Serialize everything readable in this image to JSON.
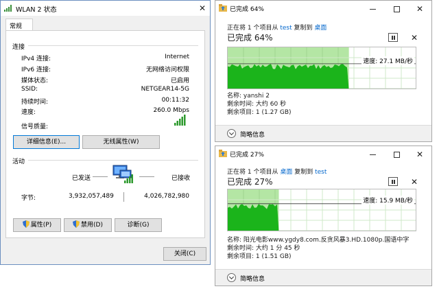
{
  "wlan": {
    "title": "WLAN 2 状态",
    "tab": "常规",
    "connection": {
      "heading": "连接",
      "rows": [
        {
          "label": "IPv4 连接:",
          "value": "Internet"
        },
        {
          "label": "IPv6 连接:",
          "value": "无网络访问权限"
        },
        {
          "label": "媒体状态:",
          "value": "已启用"
        },
        {
          "label": "SSID:",
          "value": "NETGEAR14-5G"
        },
        {
          "label": "持续时间:",
          "value": "00:11:32"
        },
        {
          "label": "速度:",
          "value": "260.0 Mbps"
        }
      ],
      "signal_label": "信号质量:",
      "signal_bars": 5
    },
    "buttons": {
      "details": "详细信息(E)...",
      "wireless_props": "无线属性(W)"
    },
    "activity": {
      "heading": "活动",
      "sent_label": "已发送",
      "received_label": "已接收",
      "bytes_label": "字节:",
      "sent_bytes": "3,932,057,489",
      "received_bytes": "4,026,782,980"
    },
    "action_buttons": {
      "properties": "属性(P)",
      "disable": "禁用(D)",
      "diagnose": "诊断(G)"
    },
    "close_button": "关闭(C)"
  },
  "copy1": {
    "title": "已完成 64%",
    "line_prefix": "正在将 1 个项目从",
    "source": "test",
    "line_mid": "复制到",
    "dest": "桌面",
    "percent_text": "已完成 64%",
    "progress": 0.64,
    "speed": "速度: 27.1 MB/秒",
    "name_line": "名称: yanshi 2",
    "time_line": "剩余时间: 大约 60 秒",
    "items_line": "剩余项目: 1 (1.27 GB)",
    "footer": "简略信息"
  },
  "copy2": {
    "title": "已完成 27%",
    "line_prefix": "正在将 1 个项目从",
    "source": "桌面",
    "line_mid": "复制到",
    "dest": "test",
    "percent_text": "已完成 27%",
    "progress": 0.27,
    "speed": "速度: 15.9 MB/秒",
    "name_line": "名称: 阳光电影www.ygdy8.com.反贪风暴3.HD.1080p.国语中字",
    "time_line": "剩余时间: 大约 1 分 45 秒",
    "items_line": "剩余项目: 1 (1.51 GB)",
    "footer": "简略信息"
  },
  "colors": {
    "progress_fill": "#b4e6a4",
    "speed_fill": "#1bb41b",
    "accent": "#0078d7"
  }
}
